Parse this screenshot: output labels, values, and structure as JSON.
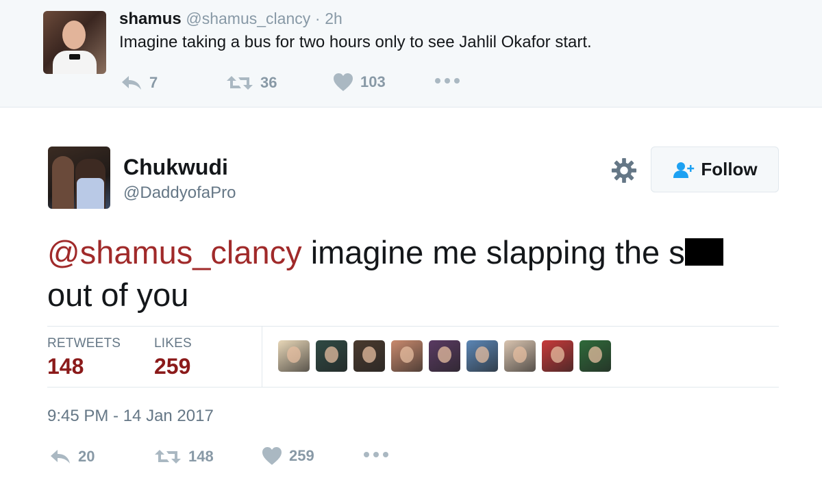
{
  "parent_tweet": {
    "name": "shamus",
    "handle": "@shamus_clancy",
    "separator": "·",
    "time": "2h",
    "text": "Imagine taking a bus for two hours only to see Jahlil Okafor start.",
    "replies": "7",
    "retweets": "36",
    "likes": "103"
  },
  "main_tweet": {
    "name": "Chukwudi",
    "handle": "@DaddyofaPro",
    "follow_label": "Follow",
    "mention": "@shamus_clancy",
    "text_before_redaction": " imagine me slapping the s",
    "text_after_redaction": "out of you",
    "stats": {
      "retweets_label": "RETWEETS",
      "retweets_value": "148",
      "likes_label": "LIKES",
      "likes_value": "259"
    },
    "date": "9:45 PM - 14 Jan 2017",
    "actions": {
      "replies": "20",
      "retweets": "148",
      "likes": "259"
    }
  },
  "colors": {
    "mention": "#a02a2a",
    "stat_value": "#8b1a1a",
    "muted": "#8899a6",
    "follow_icon": "#1da1f2"
  },
  "likers": [
    {
      "name": "liker-avatar-1",
      "color": "#e8d7b8"
    },
    {
      "name": "liker-avatar-2",
      "color": "#2f4a44"
    },
    {
      "name": "liker-avatar-3",
      "color": "#4a3a2e"
    },
    {
      "name": "liker-avatar-4",
      "color": "#c98a6e"
    },
    {
      "name": "liker-avatar-5",
      "color": "#5a3a62"
    },
    {
      "name": "liker-avatar-6",
      "color": "#5b86b5"
    },
    {
      "name": "liker-avatar-7",
      "color": "#d9c4b0"
    },
    {
      "name": "liker-avatar-8",
      "color": "#c73a3a"
    },
    {
      "name": "liker-avatar-9",
      "color": "#2f6a3a"
    }
  ]
}
